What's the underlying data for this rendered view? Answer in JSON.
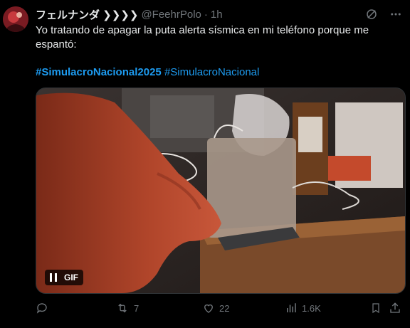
{
  "author": {
    "display_name": "フェルナンダ ❯❯❯❯",
    "handle": "@FeehrPolo",
    "separator": "·",
    "time": "1h"
  },
  "tweet": {
    "text": "Yo tratando de apagar la puta alerta sísmica en mi teléfono porque me espantó:",
    "hashtags": [
      "#SimulacroNacional2025",
      "#SimulacroNacional"
    ]
  },
  "media": {
    "type": "gif",
    "badge": "GIF",
    "control_icon": "pause-icon"
  },
  "actions": {
    "reply_count": "",
    "retweet_count": "7",
    "like_count": "22",
    "views_count": "1.6K"
  },
  "colors": {
    "background": "#000000",
    "text": "#e7e9ea",
    "secondary": "#71767b",
    "link": "#1d9bf0"
  }
}
